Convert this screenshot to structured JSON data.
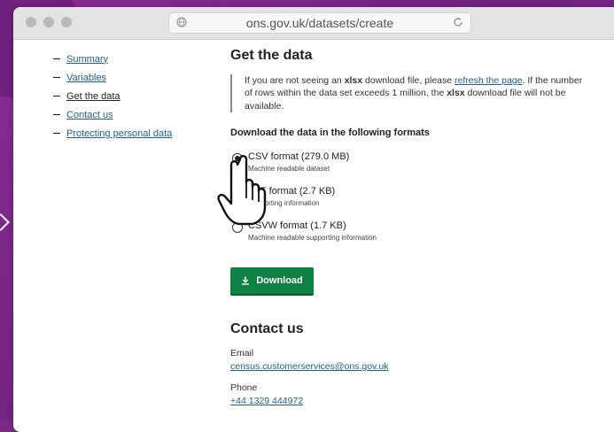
{
  "browser": {
    "url": "ons.gov.uk/datasets/create"
  },
  "sidebar": {
    "items": [
      {
        "label": "Summary"
      },
      {
        "label": "Variables"
      },
      {
        "label": "Get the data"
      },
      {
        "label": "Contact us"
      },
      {
        "label": "Protecting personal data"
      }
    ]
  },
  "main": {
    "title": "Get the data",
    "notice": {
      "part1": "If you are not seeing an ",
      "bold1": "xlsx",
      "part2": " download file, please ",
      "link": "refresh the page",
      "part3": ". If the number of rows within the data set exceeds 1 million, the ",
      "bold2": "xlsx",
      "part4": " download file will not be available."
    },
    "formats_heading": "Download the data in the following formats",
    "formats": [
      {
        "label": "CSV format (279.0 MB)",
        "sub": "Machine readable dataset",
        "checked": true
      },
      {
        "label": "TXT format (2.7 KB)",
        "sub": "Supporting information",
        "checked": false
      },
      {
        "label": "CSVW format (1.7 KB)",
        "sub": "Machine readable supporting information",
        "checked": false
      }
    ],
    "download_label": "Download"
  },
  "contact": {
    "title": "Contact us",
    "email_label": "Email",
    "email": "census.customerservices@ons.gov.uk",
    "phone_label": "Phone",
    "phone": "+44 1329 444972"
  },
  "colors": {
    "link": "#206095",
    "button": "#0f8243",
    "background": "#7a2a85"
  }
}
